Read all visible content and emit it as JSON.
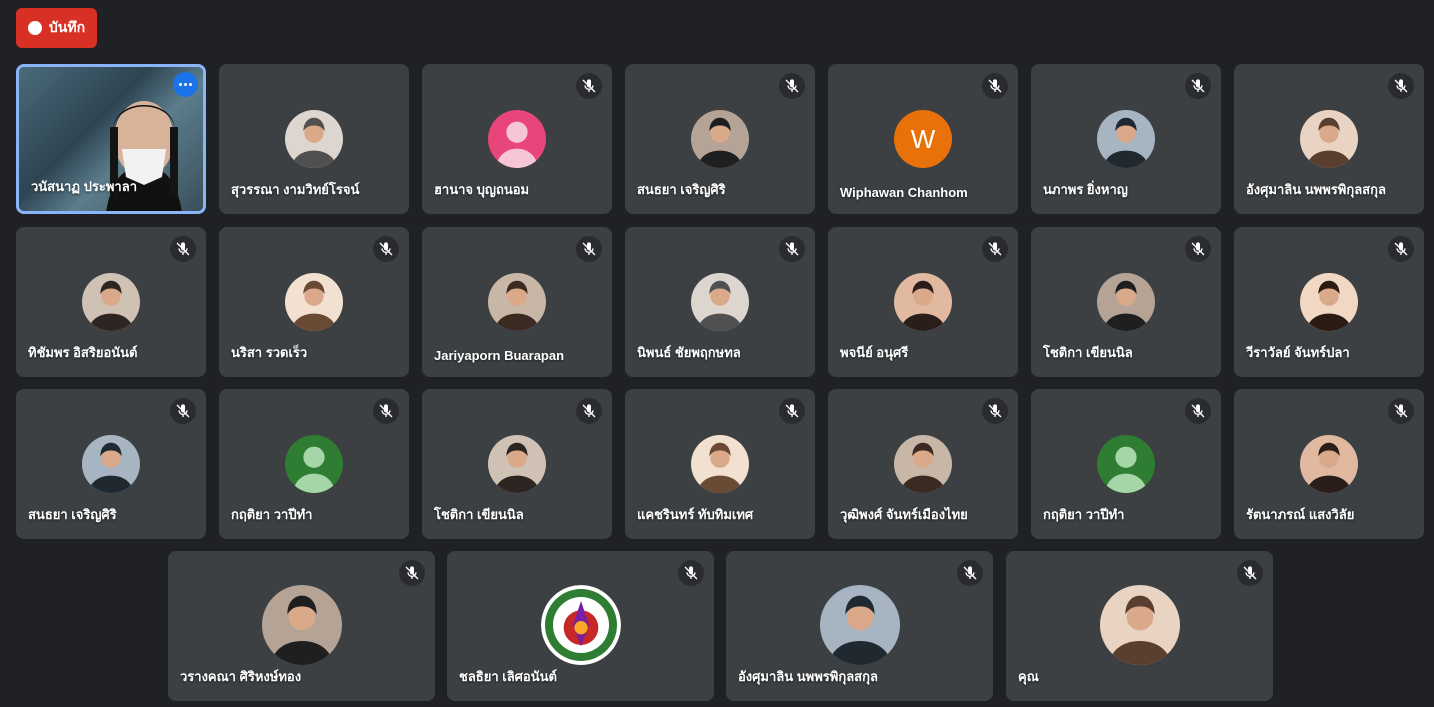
{
  "record_button": {
    "label": "บันทึก",
    "color": "#d93025"
  },
  "participants": [
    {
      "name": "วนัสนาฏ ประพาลา",
      "avatar": "video",
      "muted": false,
      "active": true
    },
    {
      "name": "สุวรรณา งามวิทย์โรจน์",
      "avatar": "photo",
      "muted": false
    },
    {
      "name": "ฮานาจ บุญถนอม",
      "avatar": "default-pink",
      "muted": true
    },
    {
      "name": "สนธยา เจริญศิริ",
      "avatar": "photo",
      "muted": true
    },
    {
      "name": "Wiphawan Chanhom",
      "avatar": "letter",
      "letter": "W",
      "color": "#e8710a",
      "muted": true
    },
    {
      "name": "นภาพร ยิ่งหาญ",
      "avatar": "photo",
      "muted": true
    },
    {
      "name": "อังศุมาลิน นพพรพิกุลสกุล",
      "avatar": "photo",
      "muted": true
    },
    {
      "name": "ทิชัมพร อิสริยอนันต์",
      "avatar": "photo",
      "muted": true
    },
    {
      "name": "นริสา รวดเร็ว",
      "avatar": "photo",
      "muted": true
    },
    {
      "name": "Jariyaporn Buarapan",
      "avatar": "photo",
      "muted": true
    },
    {
      "name": "นิพนธ์ ชัยพฤกษทล",
      "avatar": "photo",
      "muted": true
    },
    {
      "name": "พจนีย์ อนุศรี",
      "avatar": "photo",
      "muted": true
    },
    {
      "name": "โชติกา เขียนนิล",
      "avatar": "photo",
      "muted": true
    },
    {
      "name": "วีราวัลย์ จันทร์ปลา",
      "avatar": "photo",
      "muted": true
    },
    {
      "name": "สนธยา เจริญศิริ",
      "avatar": "photo",
      "muted": true
    },
    {
      "name": "กฤติยา วาปีทำ",
      "avatar": "default-green",
      "muted": true
    },
    {
      "name": "โชติกา เขียนนิล",
      "avatar": "photo",
      "muted": true
    },
    {
      "name": "แคชรินทร์ ทับทิมเทศ",
      "avatar": "photo",
      "muted": true
    },
    {
      "name": "วุฒิพงศ์ จันทร์เมืองไทย",
      "avatar": "photo",
      "muted": true
    },
    {
      "name": "กฤติยา วาปีทำ",
      "avatar": "default-green",
      "muted": true
    },
    {
      "name": "รัตนาภรณ์ แสงวิลัย",
      "avatar": "photo",
      "muted": true
    },
    {
      "name": "วรางคณา ศิริหงษ์ทอง",
      "avatar": "photo",
      "muted": true
    },
    {
      "name": "ชลธิยา เลิศอนันต์",
      "avatar": "logo",
      "muted": true
    },
    {
      "name": "อังศุมาลิน นพพรพิกุลสกุล",
      "avatar": "photo",
      "muted": true
    },
    {
      "name": "คุณ",
      "avatar": "photo",
      "muted": true
    }
  ]
}
